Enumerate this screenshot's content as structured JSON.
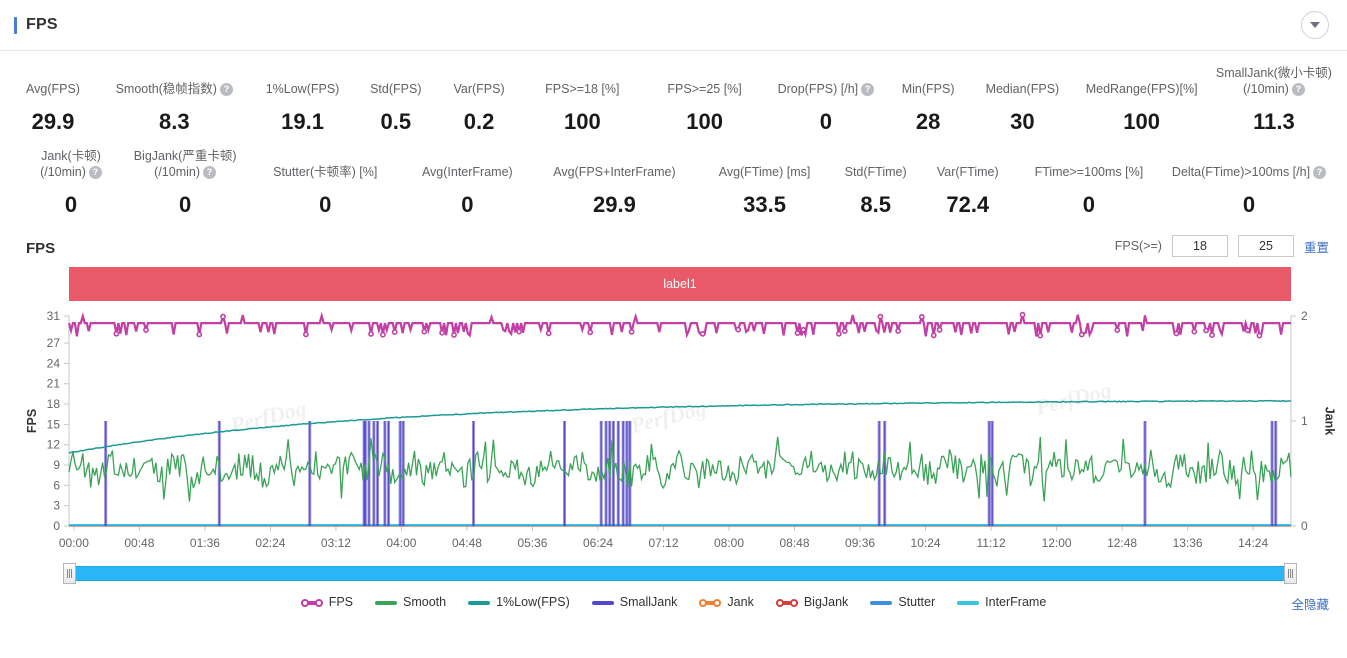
{
  "header": {
    "title": "FPS",
    "accent_color": "#4a7dd0",
    "collapse_icon": "chevron-down-icon"
  },
  "stats": {
    "row1": [
      {
        "label": "Avg(FPS)",
        "value": "29.9",
        "help": false
      },
      {
        "label": "Smooth(稳帧指数)",
        "value": "8.3",
        "help": true
      },
      {
        "label": "1%Low(FPS)",
        "value": "19.1",
        "help": false
      },
      {
        "label": "Std(FPS)",
        "value": "0.5",
        "help": false
      },
      {
        "label": "Var(FPS)",
        "value": "0.2",
        "help": false
      },
      {
        "label": "FPS>=18 [%]",
        "value": "100",
        "help": false
      },
      {
        "label": "FPS>=25 [%]",
        "value": "100",
        "help": false
      },
      {
        "label": "Drop(FPS) [/h]",
        "value": "0",
        "help": true
      },
      {
        "label": "Min(FPS)",
        "value": "28",
        "help": false
      },
      {
        "label": "Median(FPS)",
        "value": "30",
        "help": false
      },
      {
        "label": "MedRange(FPS)[%]",
        "value": "100",
        "help": false
      },
      {
        "label": "SmallJank(微小卡顿)",
        "label2": "(/10min)",
        "value": "11.3",
        "help": true
      }
    ],
    "row2": [
      {
        "label": "Jank(卡顿)",
        "label2": "(/10min)",
        "value": "0",
        "help": true
      },
      {
        "label": "BigJank(严重卡顿)",
        "label2": "(/10min)",
        "value": "0",
        "help": true
      },
      {
        "label": "Stutter(卡顿率) [%]",
        "value": "0",
        "help": false
      },
      {
        "label": "Avg(InterFrame)",
        "value": "0",
        "help": false
      },
      {
        "label": "Avg(FPS+InterFrame)",
        "value": "29.9",
        "help": false
      },
      {
        "label": "Avg(FTime) [ms]",
        "value": "33.5",
        "help": false
      },
      {
        "label": "Std(FTime)",
        "value": "8.5",
        "help": false
      },
      {
        "label": "Var(FTime)",
        "value": "72.4",
        "help": false
      },
      {
        "label": "FTime>=100ms [%]",
        "value": "0",
        "help": false
      },
      {
        "label": "Delta(FTime)>100ms [/h]",
        "value": "0",
        "help": true
      }
    ],
    "help_glyph": "?"
  },
  "chart_panel": {
    "title": "FPS",
    "threshold_label": "FPS(>=)",
    "threshold_low": "18",
    "threshold_high": "25",
    "reset_label": "重置",
    "band_label": "label1",
    "band_color": "#e8596a",
    "hide_all_label": "全隐藏",
    "watermark": "PerfDog"
  },
  "chart_data": {
    "type": "line",
    "title": "FPS",
    "xlabel": "",
    "ylabel": "FPS",
    "y2label": "Jank",
    "grid": false,
    "legend_position": "bottom",
    "x_ticks": [
      "00:00",
      "00:48",
      "01:36",
      "02:24",
      "03:12",
      "04:00",
      "04:48",
      "05:36",
      "06:24",
      "07:12",
      "08:00",
      "08:48",
      "09:36",
      "10:24",
      "11:12",
      "12:00",
      "12:48",
      "13:36",
      "14:24"
    ],
    "y_ticks": [
      0,
      3,
      6,
      9,
      12,
      15,
      18,
      21,
      24,
      27,
      31
    ],
    "ylim": [
      0,
      31
    ],
    "y2_ticks": [
      0,
      1,
      2
    ],
    "y2lim": [
      0,
      2
    ],
    "series": [
      {
        "name": "FPS",
        "color": "#c23fa5",
        "axis": "left",
        "marker": "circle",
        "mean": 29.9,
        "min": 28,
        "max": 31
      },
      {
        "name": "Smooth",
        "color": "#3aa357",
        "axis": "left",
        "marker": "none",
        "mean": 8.3,
        "min": 3.5,
        "max": 13
      },
      {
        "name": "1%Low(FPS)",
        "color": "#1a9c94",
        "axis": "left",
        "marker": "none",
        "start": 10.8,
        "end": 18.6
      },
      {
        "name": "SmallJank",
        "color": "#5548c8",
        "axis": "right",
        "marker": "none",
        "spikes": 1
      },
      {
        "name": "Jank",
        "color": "#f08033",
        "axis": "right",
        "marker": "circle",
        "value": 0
      },
      {
        "name": "BigJank",
        "color": "#d6403c",
        "axis": "right",
        "marker": "circle",
        "value": 0
      },
      {
        "name": "Stutter",
        "color": "#3e8ede",
        "axis": "right",
        "marker": "none",
        "value": 0
      },
      {
        "name": "InterFrame",
        "color": "#36c5e0",
        "axis": "left",
        "marker": "none",
        "value": 0
      }
    ]
  },
  "legend": [
    {
      "label": "FPS",
      "color": "#c23fa5",
      "marker": "dots"
    },
    {
      "label": "Smooth",
      "color": "#3aa357",
      "marker": "bar"
    },
    {
      "label": "1%Low(FPS)",
      "color": "#1a9c94",
      "marker": "bar"
    },
    {
      "label": "SmallJank",
      "color": "#5548c8",
      "marker": "bar"
    },
    {
      "label": "Jank",
      "color": "#f08033",
      "marker": "dots"
    },
    {
      "label": "BigJank",
      "color": "#d6403c",
      "marker": "dots"
    },
    {
      "label": "Stutter",
      "color": "#3e8ede",
      "marker": "bar"
    },
    {
      "label": "InterFrame",
      "color": "#36c5e0",
      "marker": "bar"
    }
  ]
}
